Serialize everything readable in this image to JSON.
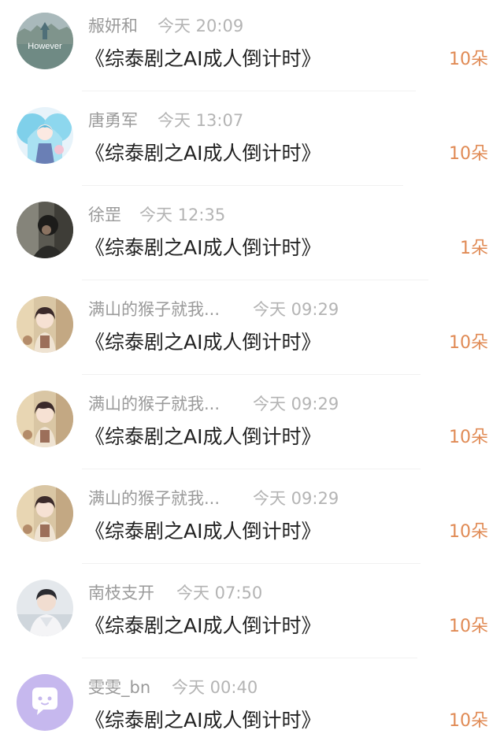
{
  "gifts": [
    {
      "user": "赧妍和",
      "time": "今天 20:09",
      "title": "《综泰剧之AI成人倒计时》",
      "amount": "10朵",
      "avatar": "however-avatar",
      "avatar_text": "However"
    },
    {
      "user": "唐勇军",
      "time": "今天 13:07",
      "title": "《综泰剧之AI成人倒计时》",
      "amount": "10朵",
      "avatar": "anime-girl-avatar"
    },
    {
      "user": "徐罡",
      "time": "今天 12:35",
      "title": "《综泰剧之AI成人倒计时》",
      "amount": "1朵",
      "avatar": "photo-avatar"
    },
    {
      "user": "满山的猴子就我...",
      "time": "今天 09:29",
      "title": "《综泰剧之AI成人倒计时》",
      "amount": "10朵",
      "avatar": "anime-boy-avatar"
    },
    {
      "user": "满山的猴子就我...",
      "time": "今天 09:29",
      "title": "《综泰剧之AI成人倒计时》",
      "amount": "10朵",
      "avatar": "anime-boy-avatar"
    },
    {
      "user": "满山的猴子就我...",
      "time": "今天 09:29",
      "title": "《综泰剧之AI成人倒计时》",
      "amount": "10朵",
      "avatar": "anime-boy-avatar"
    },
    {
      "user": "南枝支开",
      "time": "今天 07:50",
      "title": "《综泰剧之AI成人倒计时》",
      "amount": "10朵",
      "avatar": "portrait-avatar"
    },
    {
      "user": "雯雯_bn",
      "time": "今天 00:40",
      "title": "《综泰剧之AI成人倒计时》",
      "amount": "10朵",
      "avatar": "default-chat-avatar"
    }
  ],
  "colors": {
    "amount": "#e08a54",
    "username": "#9a9a9a",
    "time": "#b4b4b4",
    "title": "#222222",
    "default_avatar_bg": "#c6b8ee"
  }
}
